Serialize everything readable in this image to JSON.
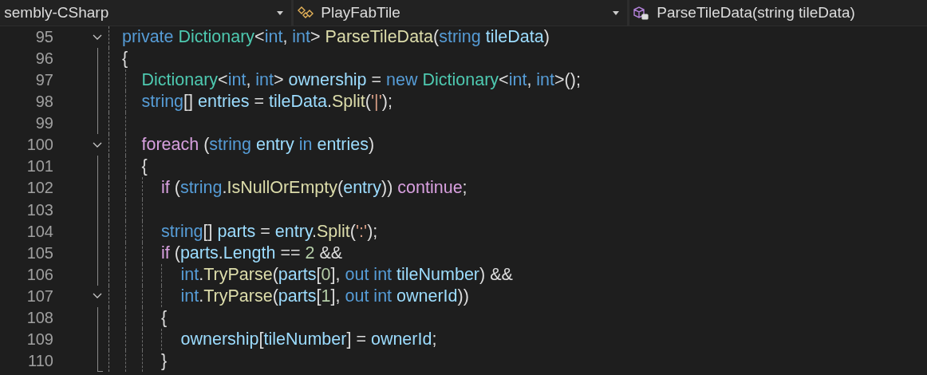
{
  "navbar": [
    {
      "label": "sembly-CSharp",
      "kind": "project"
    },
    {
      "label": "PlayFabTile",
      "kind": "class"
    },
    {
      "label": "ParseTileData(string tileData)",
      "kind": "method"
    }
  ],
  "lines": [
    {
      "number": "95",
      "kind": "fold-start",
      "tokens": [
        {
          "text": "private ",
          "kind": "keyword"
        },
        {
          "text": "Dictionary",
          "kind": "type"
        },
        {
          "text": "<",
          "kind": "plain"
        },
        {
          "text": "int",
          "kind": "keyword"
        },
        {
          "text": ", ",
          "kind": "plain"
        },
        {
          "text": "int",
          "kind": "keyword"
        },
        {
          "text": "> ",
          "kind": "plain"
        },
        {
          "text": "ParseTileData",
          "kind": "method"
        },
        {
          "text": "(",
          "kind": "plain"
        },
        {
          "text": "string ",
          "kind": "keyword"
        },
        {
          "text": "tileData",
          "kind": "variable"
        },
        {
          "text": ")",
          "kind": "plain"
        }
      ]
    },
    {
      "number": "96",
      "kind": "line",
      "tokens": [
        {
          "text": "{",
          "kind": "plain"
        }
      ],
      "children": [
        {
          "number": "97",
          "kind": "line",
          "tokens": [
            {
              "text": "Dictionary",
              "kind": "type"
            },
            {
              "text": "<",
              "kind": "plain"
            },
            {
              "text": "int",
              "kind": "keyword"
            },
            {
              "text": ", ",
              "kind": "plain"
            },
            {
              "text": "int",
              "kind": "keyword"
            },
            {
              "text": "> ",
              "kind": "plain"
            },
            {
              "text": "ownership",
              "kind": "variable"
            },
            {
              "text": " = ",
              "kind": "plain"
            },
            {
              "text": "new ",
              "kind": "keyword"
            },
            {
              "text": "Dictionary",
              "kind": "type"
            },
            {
              "text": "<",
              "kind": "plain"
            },
            {
              "text": "int",
              "kind": "keyword"
            },
            {
              "text": ", ",
              "kind": "plain"
            },
            {
              "text": "int",
              "kind": "keyword"
            },
            {
              "text": ">();",
              "kind": "plain"
            }
          ]
        },
        {
          "number": "98",
          "kind": "line",
          "tokens": [
            {
              "text": "string",
              "kind": "keyword"
            },
            {
              "text": "[] ",
              "kind": "plain"
            },
            {
              "text": "entries",
              "kind": "variable"
            },
            {
              "text": " = ",
              "kind": "plain"
            },
            {
              "text": "tileData",
              "kind": "variable"
            },
            {
              "text": ".",
              "kind": "plain"
            },
            {
              "text": "Split",
              "kind": "method"
            },
            {
              "text": "(",
              "kind": "plain"
            },
            {
              "text": "'|'",
              "kind": "string"
            },
            {
              "text": ");",
              "kind": "plain"
            }
          ]
        },
        {
          "number": "99",
          "kind": "line"
        },
        {
          "number": "100",
          "kind": "fold-start",
          "tokens": [
            {
              "text": "foreach",
              "kind": "control"
            },
            {
              "text": " (",
              "kind": "plain"
            },
            {
              "text": "string ",
              "kind": "keyword"
            },
            {
              "text": "entry ",
              "kind": "variable"
            },
            {
              "text": "in ",
              "kind": "keyword"
            },
            {
              "text": "entries",
              "kind": "variable"
            },
            {
              "text": ")",
              "kind": "plain"
            }
          ]
        },
        {
          "number": "101",
          "kind": "line",
          "tokens": [
            {
              "text": "{",
              "kind": "plain"
            }
          ],
          "children": [
            {
              "number": "102",
              "kind": "line",
              "tokens": [
                {
                  "text": "if",
                  "kind": "control"
                },
                {
                  "text": " (",
                  "kind": "plain"
                },
                {
                  "text": "string",
                  "kind": "keyword"
                },
                {
                  "text": ".",
                  "kind": "plain"
                },
                {
                  "text": "IsNullOrEmpty",
                  "kind": "method"
                },
                {
                  "text": "(",
                  "kind": "plain"
                },
                {
                  "text": "entry",
                  "kind": "variable"
                },
                {
                  "text": ")) ",
                  "kind": "plain"
                },
                {
                  "text": "continue",
                  "kind": "control"
                },
                {
                  "text": ";",
                  "kind": "plain"
                }
              ]
            },
            {
              "number": "103",
              "kind": "line"
            },
            {
              "number": "104",
              "kind": "line",
              "tokens": [
                {
                  "text": "string",
                  "kind": "keyword"
                },
                {
                  "text": "[] ",
                  "kind": "plain"
                },
                {
                  "text": "parts",
                  "kind": "variable"
                },
                {
                  "text": " = ",
                  "kind": "plain"
                },
                {
                  "text": "entry",
                  "kind": "variable"
                },
                {
                  "text": ".",
                  "kind": "plain"
                },
                {
                  "text": "Split",
                  "kind": "method"
                },
                {
                  "text": "(",
                  "kind": "plain"
                },
                {
                  "text": "':'",
                  "kind": "string"
                },
                {
                  "text": ");",
                  "kind": "plain"
                }
              ]
            },
            {
              "number": "105",
              "kind": "line",
              "tokens": [
                {
                  "text": "if",
                  "kind": "control"
                },
                {
                  "text": " (",
                  "kind": "plain"
                },
                {
                  "text": "parts",
                  "kind": "variable"
                },
                {
                  "text": ".",
                  "kind": "plain"
                },
                {
                  "text": "Length",
                  "kind": "variable"
                },
                {
                  "text": " == ",
                  "kind": "plain"
                },
                {
                  "text": "2",
                  "kind": "number"
                },
                {
                  "text": " &&",
                  "kind": "plain"
                }
              ],
              "children": [
                {
                  "number": "106",
                  "kind": "line",
                  "tokens": [
                    {
                      "text": "int",
                      "kind": "keyword"
                    },
                    {
                      "text": ".",
                      "kind": "plain"
                    },
                    {
                      "text": "TryParse",
                      "kind": "method"
                    },
                    {
                      "text": "(",
                      "kind": "plain"
                    },
                    {
                      "text": "parts",
                      "kind": "variable"
                    },
                    {
                      "text": "[",
                      "kind": "plain"
                    },
                    {
                      "text": "0",
                      "kind": "number"
                    },
                    {
                      "text": "], ",
                      "kind": "plain"
                    },
                    {
                      "text": "out ",
                      "kind": "keyword"
                    },
                    {
                      "text": "int ",
                      "kind": "keyword"
                    },
                    {
                      "text": "tileNumber",
                      "kind": "variable"
                    },
                    {
                      "text": ") &&",
                      "kind": "plain"
                    }
                  ]
                },
                {
                  "number": "107",
                  "kind": "fold-start",
                  "tokens": [
                    {
                      "text": "int",
                      "kind": "keyword"
                    },
                    {
                      "text": ".",
                      "kind": "plain"
                    },
                    {
                      "text": "TryParse",
                      "kind": "method"
                    },
                    {
                      "text": "(",
                      "kind": "plain"
                    },
                    {
                      "text": "parts",
                      "kind": "variable"
                    },
                    {
                      "text": "[",
                      "kind": "plain"
                    },
                    {
                      "text": "1",
                      "kind": "number"
                    },
                    {
                      "text": "], ",
                      "kind": "plain"
                    },
                    {
                      "text": "out ",
                      "kind": "keyword"
                    },
                    {
                      "text": "int ",
                      "kind": "keyword"
                    },
                    {
                      "text": "ownerId",
                      "kind": "variable"
                    },
                    {
                      "text": "))",
                      "kind": "plain"
                    }
                  ]
                }
              ]
            },
            {
              "number": "108",
              "kind": "line",
              "tokens": [
                {
                  "text": "{",
                  "kind": "plain"
                }
              ],
              "children": [
                {
                  "number": "109",
                  "kind": "line",
                  "tokens": [
                    {
                      "text": "ownership",
                      "kind": "variable"
                    },
                    {
                      "text": "[",
                      "kind": "plain"
                    },
                    {
                      "text": "tileNumber",
                      "kind": "variable"
                    },
                    {
                      "text": "] = ",
                      "kind": "plain"
                    },
                    {
                      "text": "ownerId",
                      "kind": "variable"
                    },
                    {
                      "text": ";",
                      "kind": "plain"
                    }
                  ]
                }
              ]
            },
            {
              "number": "110",
              "kind": "fold-end",
              "tokens": [
                {
                  "text": "}",
                  "kind": "plain"
                }
              ]
            }
          ]
        }
      ]
    }
  ]
}
